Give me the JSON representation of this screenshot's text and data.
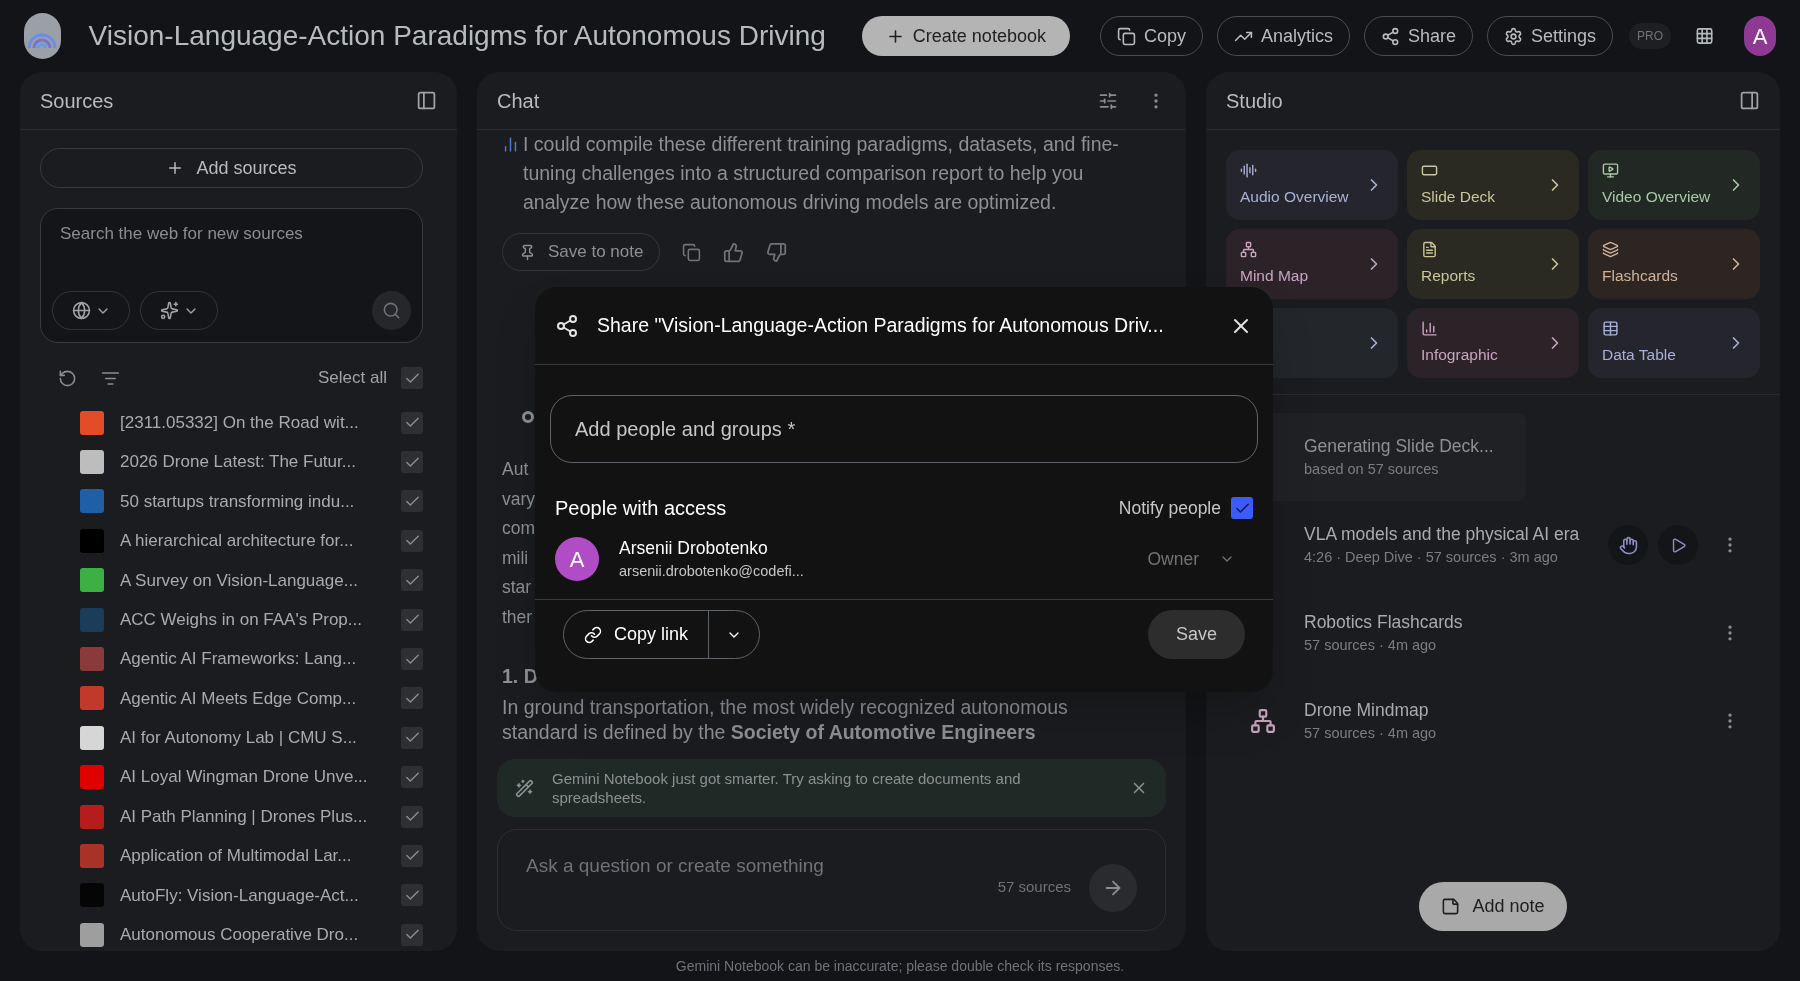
{
  "app": {
    "title": "Vision-Language-Action Paradigms for Autonomous Driving",
    "badge": "PRO",
    "avatar": "A"
  },
  "header_buttons": [
    {
      "label": "Create notebook",
      "kind": "create"
    },
    {
      "label": "Copy",
      "kind": "copy"
    },
    {
      "label": "Analytics",
      "kind": "analytics"
    },
    {
      "label": "Share",
      "kind": "share"
    },
    {
      "label": "Settings",
      "kind": "settings"
    }
  ],
  "sources": {
    "title": "Sources",
    "add_button": "Add sources",
    "search": {
      "placeholder": "Search the web for new sources"
    },
    "select_all": {
      "label": "Select all",
      "checked": true
    },
    "items": [
      {
        "title": "[2311.05332] On the Road wit...",
        "checked": true,
        "color": "#e34c26"
      },
      {
        "title": "2026 Drone Latest: The Futur...",
        "checked": true,
        "color": "#bdbdbd"
      },
      {
        "title": "50 startups transforming indu...",
        "checked": true,
        "color": "#1f5fa8"
      },
      {
        "title": "A hierarchical architecture for...",
        "checked": true,
        "color": "#000000"
      },
      {
        "title": "A Survey on Vision-Language...",
        "checked": true,
        "color": "#3cb043"
      },
      {
        "title": "ACC Weighs in on FAA's Prop...",
        "checked": true,
        "color": "#1c3d5a"
      },
      {
        "title": "Agentic AI Frameworks: Lang...",
        "checked": true,
        "color": "#8b3a3a"
      },
      {
        "title": "Agentic AI Meets Edge Comp...",
        "checked": true,
        "color": "#c0392b"
      },
      {
        "title": "AI for Autonomy Lab | CMU S...",
        "checked": true,
        "color": "#d6d6d6"
      },
      {
        "title": "AI Loyal Wingman Drone Unve...",
        "checked": true,
        "color": "#e00000"
      },
      {
        "title": "AI Path Planning | Drones Plus...",
        "checked": true,
        "color": "#b71c1c"
      },
      {
        "title": "Application of Multimodal Lar...",
        "checked": true,
        "color": "#a93226"
      },
      {
        "title": "AutoFly: Vision-Language-Act...",
        "checked": true,
        "color": "#050505"
      },
      {
        "title": "Autonomous Cooperative Dro...",
        "checked": true,
        "color": "#9e9e9e"
      }
    ]
  },
  "chat": {
    "title": "Chat",
    "message": "I could compile these different training paradigms, datasets, and fine-tuning challenges into a structured comparison report to help you analyze how these autonomous driving models are optimized.",
    "save_button": "Save to note",
    "fragments": [
      "Aut",
      "vary",
      "com",
      "mili",
      "star",
      "ther"
    ],
    "heading": "1. D",
    "paragraph": "In ground transportation, the most widely recognized autonomous standard is defined by the **Society of Automotive Engineers**",
    "banner": "Gemini Notebook just got smarter. Try asking to create documents and spreadsheets.",
    "input": {
      "placeholder": "Ask a question or create something"
    },
    "source_count": "57 sources"
  },
  "studio": {
    "title": "Studio",
    "tiles": [
      {
        "label": "Audio Overview",
        "kind": "audio",
        "color": "#a9b0d8"
      },
      {
        "label": "Slide Deck",
        "kind": "slides",
        "color": "#c8c69a"
      },
      {
        "label": "Video Overview",
        "kind": "video",
        "color": "#a8c8a8"
      },
      {
        "label": "Mind Map",
        "kind": "mindmap",
        "color": "#c9a3c0"
      },
      {
        "label": "Reports",
        "kind": "reports",
        "color": "#c8c69a"
      },
      {
        "label": "Flashcards",
        "kind": "flashcards",
        "color": "#d0b29a"
      },
      {
        "kind": "blank",
        "color": "#a9b0d8"
      },
      {
        "label": "Infographic",
        "kind": "infographic",
        "color": "#c9a3c0"
      },
      {
        "label": "Data Table",
        "kind": "table",
        "color": "#a9b0d8"
      }
    ],
    "items": [
      {
        "kind": "generating",
        "title": "Generating Slide Deck...",
        "subtitle": "based on 57 sources"
      },
      {
        "kind": "audio",
        "title": "VLA models and the physical AI era",
        "subtitle": "4:26 · Deep Dive · 57 sources · 3m ago"
      },
      {
        "kind": "flashcards",
        "title": "Robotics Flashcards",
        "subtitle": "57 sources · 4m ago"
      },
      {
        "kind": "mindmap",
        "title": "Drone Mindmap",
        "subtitle": "57 sources · 4m ago"
      }
    ],
    "add_note": "Add note"
  },
  "dialog": {
    "title": "Share \"Vision-Language-Action Paradigms for Autonomous Driv...",
    "field": {
      "placeholder": "Add people and groups *"
    },
    "section": "People with access",
    "notify": {
      "label": "Notify people",
      "checked": true
    },
    "person": {
      "avatar": "A",
      "name": "Arsenii Drobotenko",
      "email": "arsenii.drobotenko@codefi...",
      "role": "Owner"
    },
    "copy_link": "Copy link",
    "save": "Save"
  },
  "footer": "Gemini Notebook can be inaccurate; please double check its responses."
}
